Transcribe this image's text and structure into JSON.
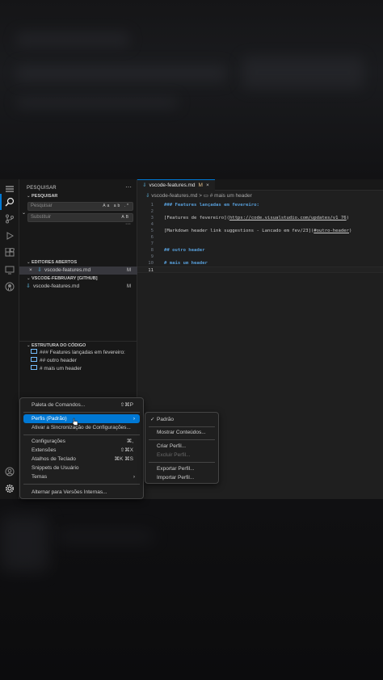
{
  "sidebar": {
    "title": "PESQUISAR",
    "more": "···",
    "search_section": "PESQUISAR",
    "search_placeholder": "Pesquisar",
    "search_options": "Aa ab .*",
    "replace_placeholder": "Substituir",
    "replace_option": "AB",
    "results_more": "···",
    "open_editors_title": "EDITORES ABERTOS",
    "open_editors": [
      {
        "name": "vscode-features.md",
        "badge": "M"
      }
    ],
    "workspace_title": "VSCODE-FEBRUARY [GITHUB]",
    "workspace_files": [
      {
        "name": "vscode-features.md",
        "badge": "M"
      }
    ],
    "outline_title": "ESTRUTURA DO CÓDIGO",
    "outline": [
      {
        "label": "### Features lançadas em fevereiro:"
      },
      {
        "label": "## outro header"
      },
      {
        "label": "# mais um header"
      }
    ]
  },
  "editor": {
    "tab_name": "vscode-features.md",
    "tab_mod": "M",
    "tab_close": "×",
    "breadcrumb_file": "vscode-features.md",
    "breadcrumb_sep": ">",
    "breadcrumb_symbol": "# mais um header",
    "lines": [
      {
        "num": "1",
        "text": "### Features lançadas em fevereiro:",
        "kind": "h"
      },
      {
        "num": "2",
        "text": "",
        "kind": ""
      },
      {
        "num": "3",
        "text": "[Features de fevereiro](",
        "url": "https://code.visualstudio.com/updates/v1_76",
        "tail": ")",
        "kind": "link"
      },
      {
        "num": "4",
        "text": "",
        "kind": ""
      },
      {
        "num": "5",
        "text": "[Markdown header link suggestions - Lancado em fev/23](",
        "url": "#outro-header",
        "tail": ")",
        "kind": "link"
      },
      {
        "num": "6",
        "text": "",
        "kind": ""
      },
      {
        "num": "7",
        "text": "",
        "kind": ""
      },
      {
        "num": "8",
        "text": "## outro header",
        "kind": "h"
      },
      {
        "num": "9",
        "text": "",
        "kind": ""
      },
      {
        "num": "10",
        "text": "# mais um header",
        "kind": "h"
      },
      {
        "num": "11",
        "text": "",
        "kind": "cur"
      }
    ]
  },
  "manage_menu": {
    "items": [
      {
        "label": "Paleta de Comandos...",
        "kb": "⇧⌘P"
      },
      {
        "label": "Perfis (Padrão)",
        "sub": "›",
        "hover": true
      },
      {
        "label": "Ativar a Sincronização de Configurações..."
      },
      {
        "label": "Configurações",
        "kb": "⌘,"
      },
      {
        "label": "Extensões",
        "kb": "⇧⌘X"
      },
      {
        "label": "Atalhos de Teclado",
        "kb": "⌘K ⌘S"
      },
      {
        "label": "Snippets de Usuário"
      },
      {
        "label": "Temas",
        "sub": "›"
      },
      {
        "label": "Alternar para Versões Internas..."
      }
    ]
  },
  "profiles_menu": {
    "checked": "✓",
    "items": [
      {
        "label": "Padrão"
      },
      {
        "label": "Mostrar Conteúdos..."
      },
      {
        "label": "Criar Perfil..."
      },
      {
        "label": "Excluir Perfil...",
        "disabled": true
      },
      {
        "label": "Exportar Perfil..."
      },
      {
        "label": "Importar Perfil..."
      }
    ]
  },
  "colors": {
    "accent": "#0078d4",
    "heading": "#569cd6",
    "markdown_icon": "#519aba",
    "modified": "#e2c08d"
  }
}
